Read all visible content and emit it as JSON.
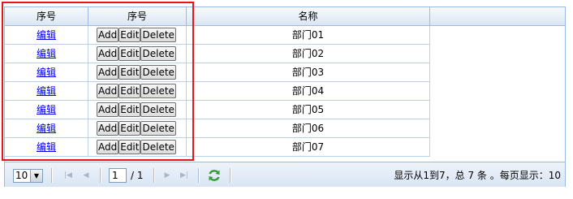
{
  "columns": [
    "序号",
    "序号",
    "名称"
  ],
  "rows": [
    {
      "edit_link": "编辑",
      "add": "Add",
      "edit": "Edit",
      "delete": "Delete",
      "name": "部门01"
    },
    {
      "edit_link": "编辑",
      "add": "Add",
      "edit": "Edit",
      "delete": "Delete",
      "name": "部门02"
    },
    {
      "edit_link": "编辑",
      "add": "Add",
      "edit": "Edit",
      "delete": "Delete",
      "name": "部门03"
    },
    {
      "edit_link": "编辑",
      "add": "Add",
      "edit": "Edit",
      "delete": "Delete",
      "name": "部门04"
    },
    {
      "edit_link": "编辑",
      "add": "Add",
      "edit": "Edit",
      "delete": "Delete",
      "name": "部门05"
    },
    {
      "edit_link": "编辑",
      "add": "Add",
      "edit": "Edit",
      "delete": "Delete",
      "name": "部门06"
    },
    {
      "edit_link": "编辑",
      "add": "Add",
      "edit": "Edit",
      "delete": "Delete",
      "name": "部门07"
    }
  ],
  "pager": {
    "page_size": "10",
    "current_page": "1",
    "total_pages": "/ 1",
    "info": "显示从1到7，总 7 条 。每页显示：10"
  },
  "icons": {
    "first": "first-page-icon",
    "prev": "prev-page-icon",
    "next": "next-page-icon",
    "last": "last-page-icon",
    "refresh": "refresh-icon"
  },
  "colors": {
    "highlight_box": "#e8141c",
    "border": "#99bbe8",
    "link": "#0000ee"
  }
}
